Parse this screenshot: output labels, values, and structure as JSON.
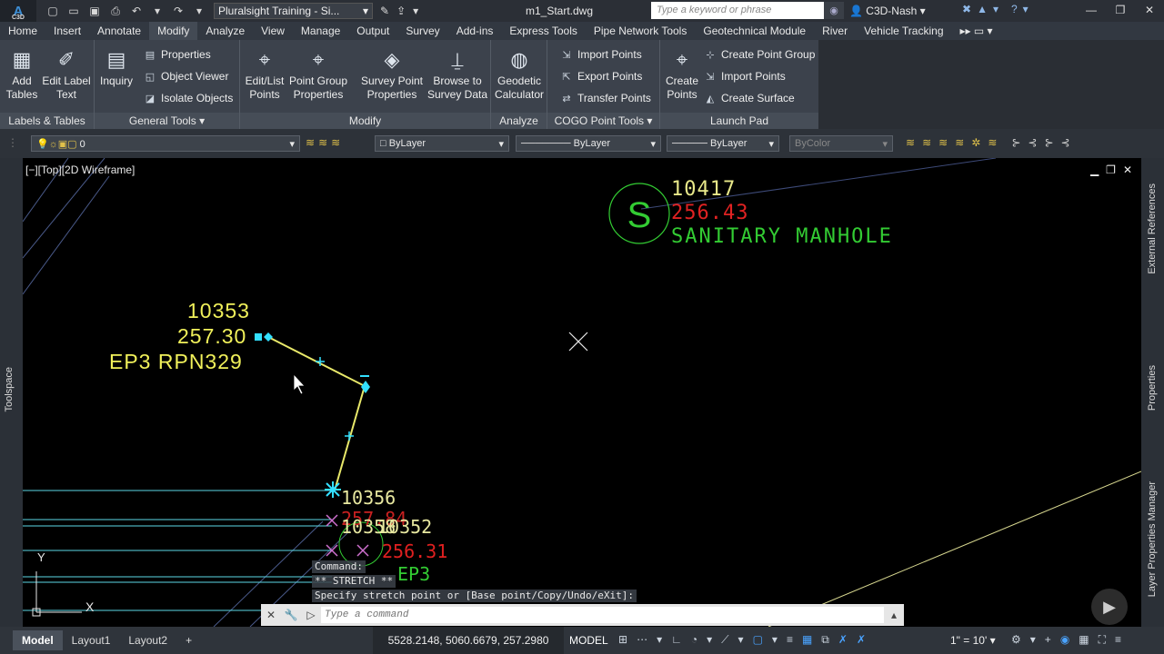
{
  "titlebar": {
    "app_glyph": "A",
    "app_sub": "C3D",
    "workspace": "Pluralsight Training - Si...",
    "document_title": "m1_Start.dwg",
    "search_placeholder": "Type a keyword or phrase",
    "user": "C3D-Nash"
  },
  "tabs": [
    "Home",
    "Insert",
    "Annotate",
    "Modify",
    "Analyze",
    "View",
    "Manage",
    "Output",
    "Survey",
    "Add-ins",
    "Express Tools",
    "Pipe Network Tools",
    "Geotechnical Module",
    "River",
    "Vehicle Tracking"
  ],
  "ribbon": {
    "add_tables": "Add Tables",
    "edit_label_text": "Edit Label Text",
    "inquiry": "Inquiry",
    "properties": "Properties",
    "object_viewer": "Object Viewer",
    "isolate_objects": "Isolate Objects",
    "edit_list_points": "Edit/List Points",
    "point_group_properties": "Point Group Properties",
    "survey_point_properties": "Survey Point Properties",
    "browse_to_survey_data": "Browse to Survey Data",
    "geodetic_calculator": "Geodetic Calculator",
    "import_points": "Import Points",
    "export_points": "Export Points",
    "transfer_points": "Transfer Points",
    "create_points": "Create Points",
    "create_point_group": "Create Point Group",
    "import_points_2": "Import Points",
    "create_surface": "Create Surface",
    "panels": {
      "labels_tables": "Labels & Tables",
      "general_tools": "General Tools",
      "modify": "Modify",
      "analyze": "Analyze",
      "cogo_point_tools": "COGO Point Tools",
      "launch_pad": "Launch Pad"
    }
  },
  "properties_bar": {
    "layer": "0",
    "color": "ByLayer",
    "linetype": "ByLayer",
    "lineweight": "ByLayer",
    "plotstyle": "ByColor"
  },
  "viewport": {
    "label": "[−][Top][2D Wireframe]"
  },
  "drawing_text": {
    "manhole_number": "10417",
    "manhole_elevation": "256.43",
    "manhole_desc": "SANITARY MANHOLE",
    "pt1_number": "10353",
    "pt1_elevation": "257.30",
    "pt1_desc": "EP3 RPN329",
    "pt2_number": "10356",
    "pt2_elevation": "257.84",
    "pt3_number": "10358",
    "pt3_number_overlap": "10352",
    "pt3_elevation": "256.31",
    "pt3_desc": "EP3",
    "axis_y": "Y",
    "axis_x": "X"
  },
  "right_palettes": [
    "External References",
    "Properties",
    "Layer Properties Manager"
  ],
  "left_palette": "Toolspace",
  "command": {
    "history_1": "Command:",
    "history_2": "** STRETCH **",
    "history_3": "Specify stretch point or [Base point/Copy/Undo/eXit]:",
    "placeholder": "Type a command"
  },
  "statusbar": {
    "model_tab": "Model",
    "layout1": "Layout1",
    "layout2": "Layout2",
    "add_tab": "+",
    "coordinates": "5528.2148, 5060.6679, 257.2980",
    "space": "MODEL",
    "scale": "1\" = 10'"
  }
}
